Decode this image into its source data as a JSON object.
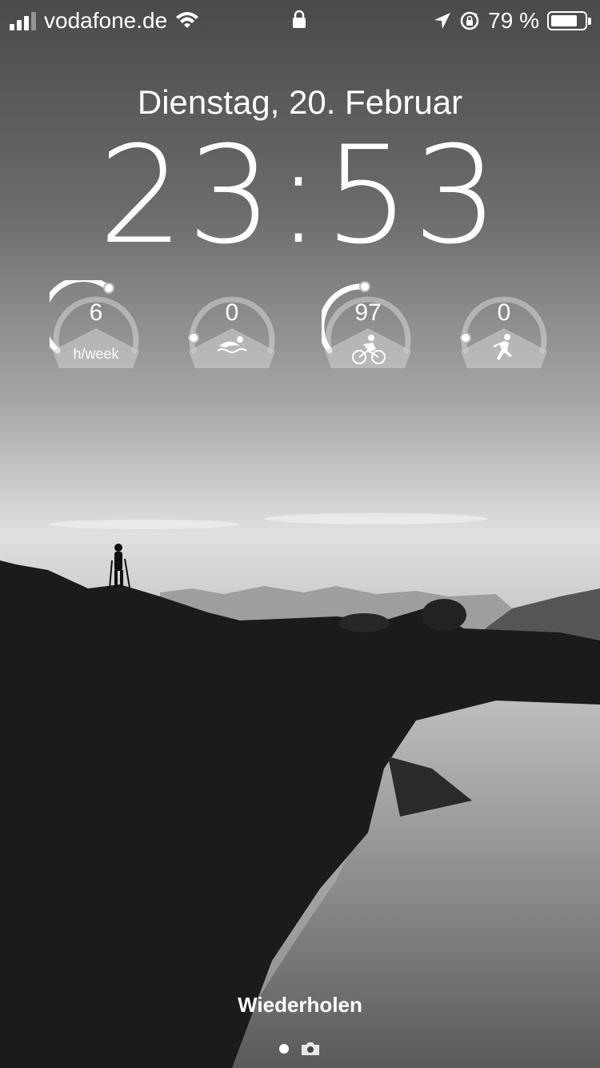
{
  "status_bar": {
    "carrier": "vodafone.de",
    "battery_text": "79 %",
    "battery_level": 0.79,
    "signal_bars": 3,
    "icons": [
      "signal-icon",
      "wifi-icon",
      "lock-icon",
      "location-arrow-icon",
      "rotation-lock-icon",
      "battery-icon"
    ]
  },
  "lock_screen": {
    "date": "Dienstag, 20. Februar",
    "time": "23:53"
  },
  "widgets": [
    {
      "name": "weekly-hours",
      "value": "6",
      "label": "h/week",
      "icon": "",
      "progress": 0.65
    },
    {
      "name": "swim",
      "value": "0",
      "label": "",
      "icon": "swimmer-icon",
      "progress": 0.0
    },
    {
      "name": "cycling",
      "value": "97",
      "label": "",
      "icon": "cyclist-icon",
      "progress": 0.5
    },
    {
      "name": "running",
      "value": "0",
      "label": "",
      "icon": "runner-icon",
      "progress": 0.0
    }
  ],
  "bottom": {
    "action_label": "Wiederholen",
    "page_dots": [
      "dot-active",
      "camera-icon"
    ]
  },
  "colors": {
    "text": "#ffffff"
  }
}
